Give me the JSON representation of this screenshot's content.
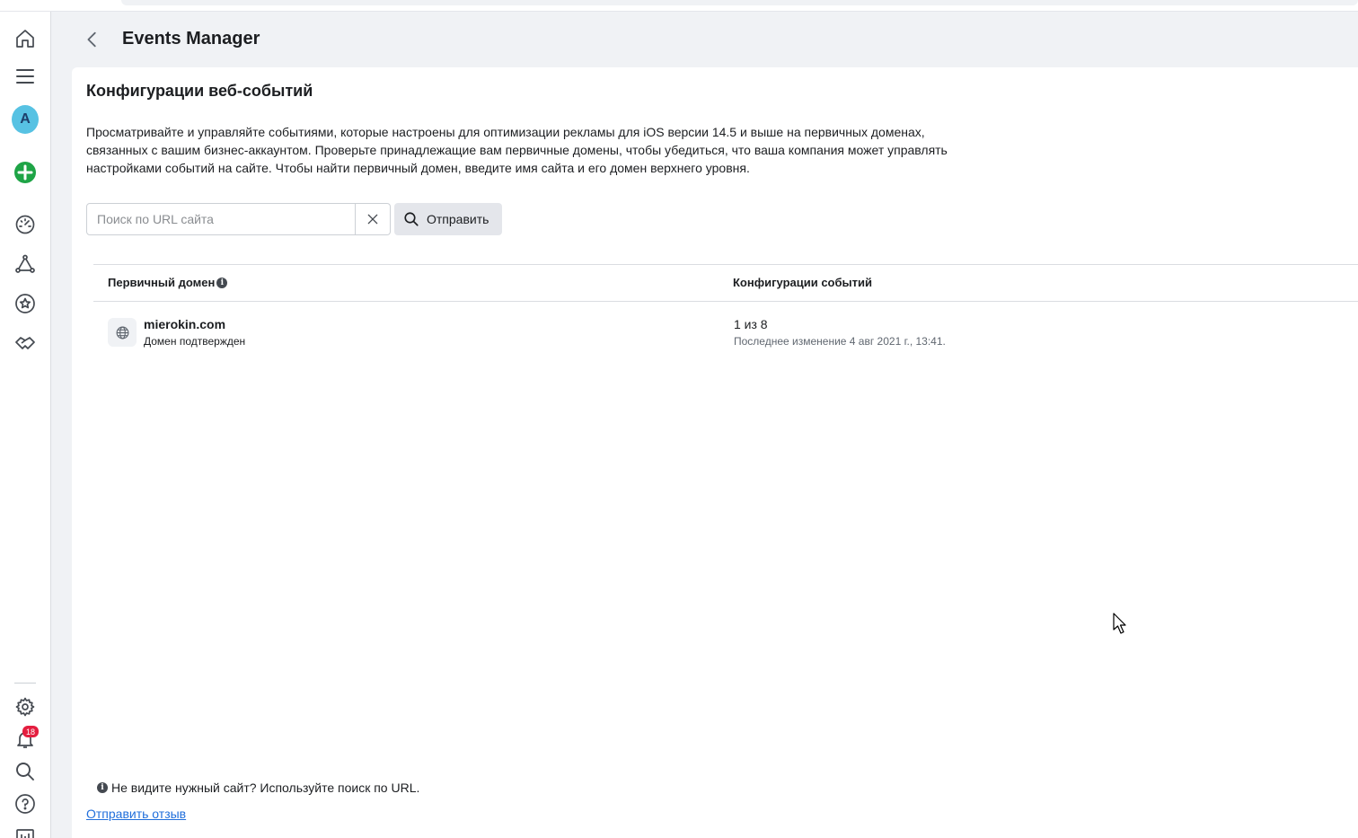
{
  "header": {
    "title": "Events Manager"
  },
  "sidebar": {
    "avatar_letter": "A",
    "notifications_count": "18",
    "icons": [
      "home-icon",
      "menu-icon",
      "avatar",
      "create-icon",
      "dashboard-icon",
      "data-sources-icon",
      "star-icon",
      "partner-icon",
      "settings-icon",
      "bell-icon",
      "search-icon",
      "help-icon",
      "report-icon"
    ]
  },
  "main": {
    "title": "Конфигурации веб-событий",
    "description": "Просматривайте и управляйте событиями, которые настроены для оптимизации рекламы для iOS версии 14.5 и выше на первичных доменах, связанных с вашим бизнес-аккаунтом. Проверьте принадлежащие вам первичные домены, чтобы убедиться, что ваша компания может управлять настройками событий на сайте. Чтобы найти первичный домен, введите имя сайта и его домен верхнего уровня.",
    "search": {
      "placeholder": "Поиск по URL сайта",
      "value": "",
      "submit_label": "Отправить"
    },
    "table": {
      "columns": [
        "Первичный домен",
        "Конфигурации событий"
      ],
      "rows": [
        {
          "domain": "mierokin.com",
          "status": "Домен подтвержден",
          "config_count": "1 из 8",
          "last_modified": "Последнее изменение 4 авг 2021 г., 13:41."
        }
      ]
    },
    "footer": {
      "note": "Не видите нужный сайт? Используйте поиск по URL.",
      "feedback_link": "Отправить отзыв"
    }
  },
  "colors": {
    "accent_link": "#216fdb",
    "avatar_bg": "#57c2e3",
    "create_green": "#1ea446",
    "badge_red": "#e41e3f"
  }
}
